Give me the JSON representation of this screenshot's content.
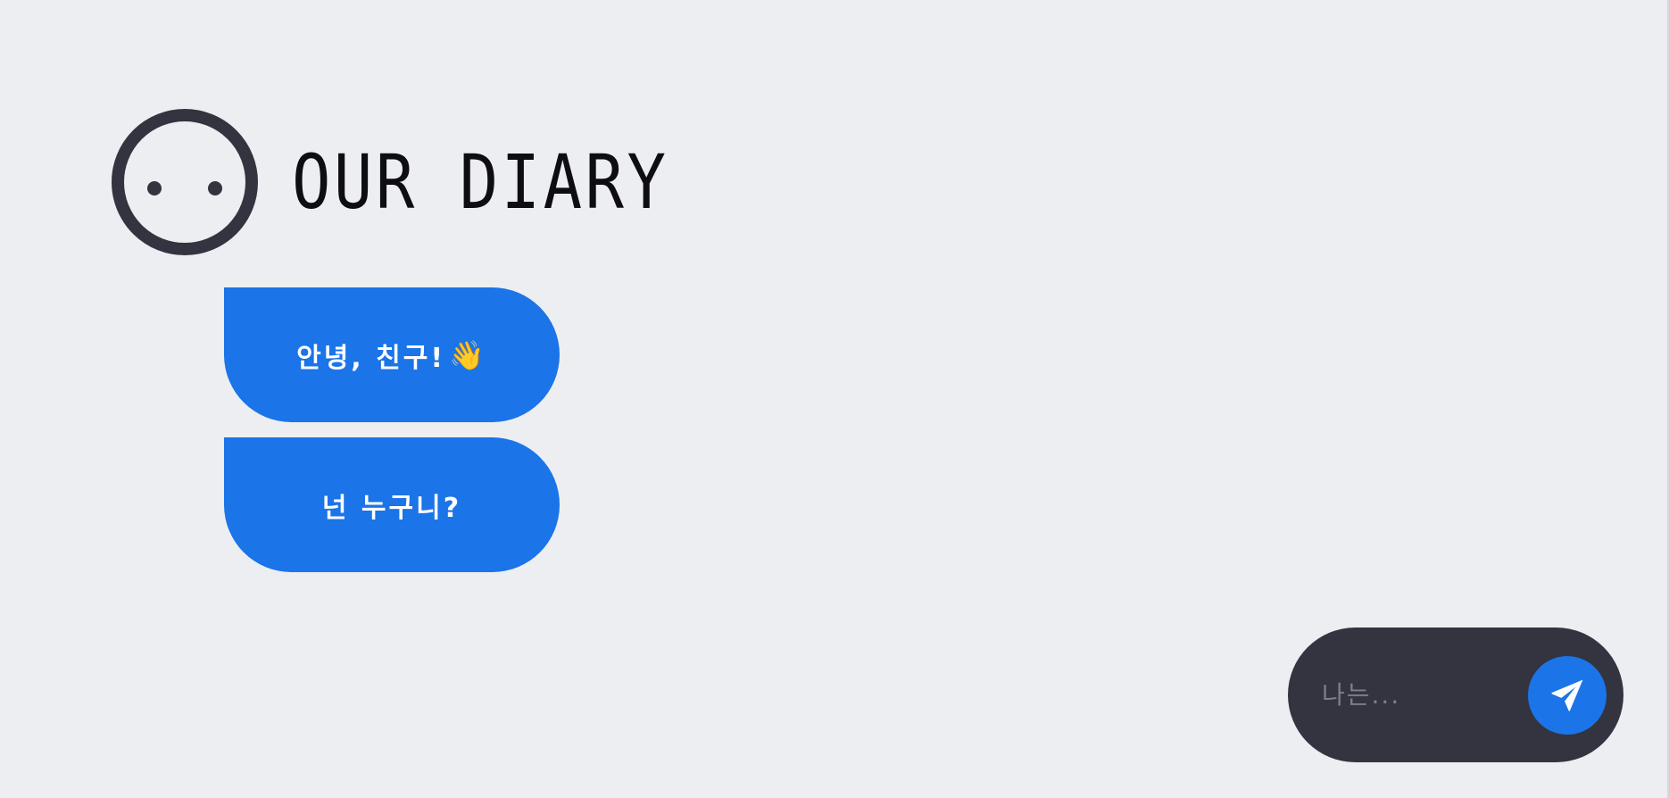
{
  "header": {
    "title": "OUR DIARY",
    "logo_icon": "face-icon"
  },
  "messages": [
    {
      "text": "안녕, 친구!",
      "emoji": "👋"
    },
    {
      "text": "넌 누구니?"
    }
  ],
  "composer": {
    "value": "",
    "placeholder": "나는...",
    "send_icon": "paper-plane-icon"
  },
  "colors": {
    "background": "#edeef2",
    "dark": "#33343f",
    "accent": "#1b74e8",
    "text_light": "#ffffff",
    "placeholder": "#7e7f88"
  }
}
